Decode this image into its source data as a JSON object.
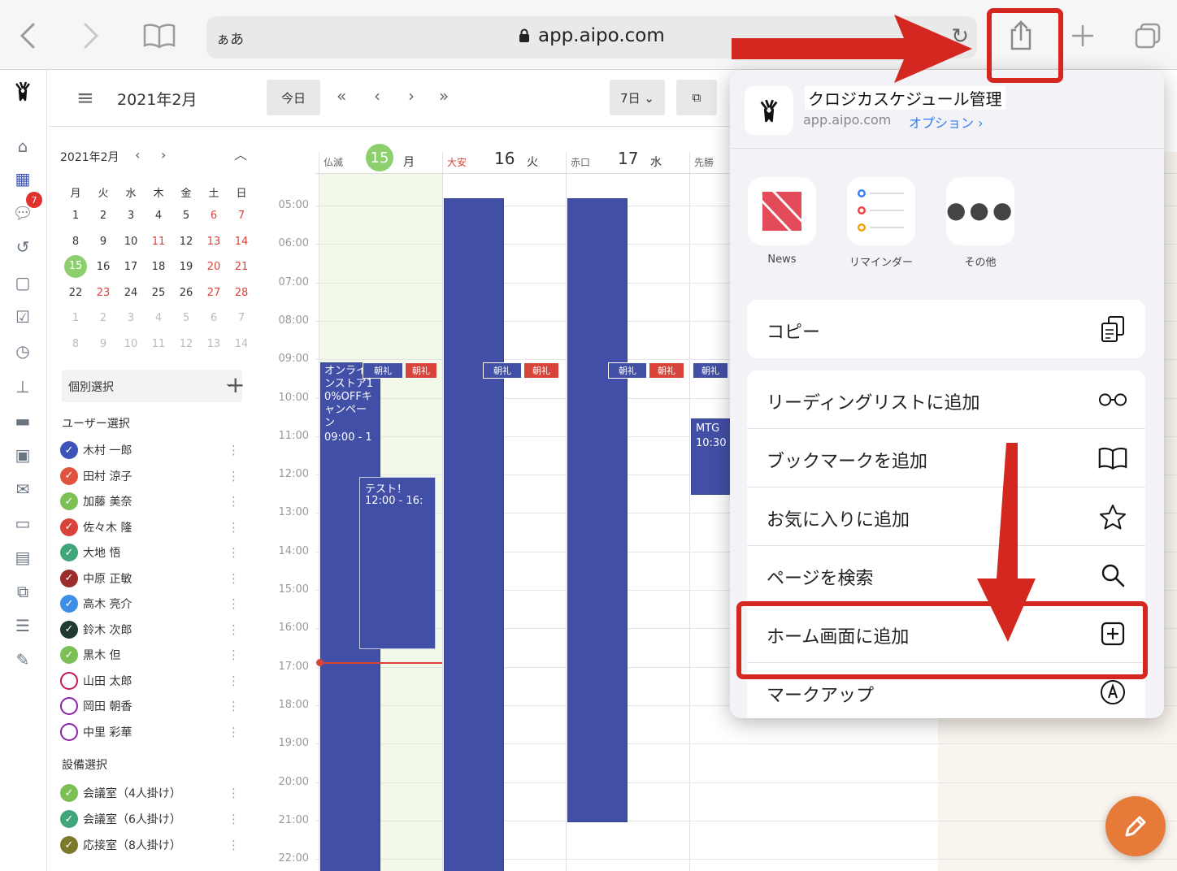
{
  "browser": {
    "text_size_label": "ぁあ",
    "url": "app.aipo.com"
  },
  "sidebar": {
    "chat_badge": "7"
  },
  "header": {
    "month_title": "2021年2月",
    "today_button": "今日",
    "range_select": "7日 ⌄"
  },
  "mini_calendar": {
    "title": "2021年2月",
    "prev": "‹",
    "next": "›",
    "weekdays": [
      "月",
      "火",
      "水",
      "木",
      "金",
      "土",
      "日"
    ],
    "weeks": [
      [
        "1",
        "2",
        "3",
        "4",
        "5",
        "6",
        "7"
      ],
      [
        "8",
        "9",
        "10",
        "11",
        "12",
        "13",
        "14"
      ],
      [
        "15",
        "16",
        "17",
        "18",
        "19",
        "20",
        "21"
      ],
      [
        "22",
        "23",
        "24",
        "25",
        "26",
        "27",
        "28"
      ],
      [
        "1",
        "2",
        "3",
        "4",
        "5",
        "6",
        "7"
      ],
      [
        "8",
        "9",
        "10",
        "11",
        "12",
        "13",
        "14"
      ]
    ]
  },
  "filters": {
    "group_select": "個別選択",
    "user_section": "ユーザー選択",
    "users": [
      {
        "name": "木村 一郎",
        "color": "#3d53b8",
        "checked": true
      },
      {
        "name": "田村 涼子",
        "color": "#e0533c",
        "checked": true
      },
      {
        "name": "加藤 美奈",
        "color": "#7cbf55",
        "checked": true
      },
      {
        "name": "佐々木 隆",
        "color": "#d9443a",
        "checked": true
      },
      {
        "name": "大地 悟",
        "color": "#3fa57a",
        "checked": true
      },
      {
        "name": "中原 正敏",
        "color": "#9b2d2d",
        "checked": true
      },
      {
        "name": "高木 亮介",
        "color": "#3d8ee6",
        "checked": true
      },
      {
        "name": "鈴木 次郎",
        "color": "#1f3a32",
        "checked": true
      },
      {
        "name": "黒木 但",
        "color": "#7cbf55",
        "checked": true
      },
      {
        "name": "山田 太郎",
        "color": "#c2185b",
        "checked": false
      },
      {
        "name": "岡田 朝香",
        "color": "#8e24aa",
        "checked": false
      },
      {
        "name": "中里 彩華",
        "color": "#8e24aa",
        "checked": false
      }
    ],
    "facility_section": "設備選択",
    "facilities": [
      {
        "name": "会議室（4人掛け）",
        "color": "#7cbf55"
      },
      {
        "name": "会議室（6人掛け）",
        "color": "#3fa57a"
      },
      {
        "name": "応接室（8人掛け）",
        "color": "#7a7a2a"
      }
    ]
  },
  "days": [
    {
      "rokuyo": "仏滅",
      "date": "15",
      "dow": "月",
      "today": true
    },
    {
      "rokuyo": "大安",
      "date": "16",
      "dow": "火",
      "today": false
    },
    {
      "rokuyo": "赤口",
      "date": "17",
      "dow": "水",
      "today": false
    },
    {
      "rokuyo": "先勝",
      "date": "",
      "dow": "",
      "today": false
    }
  ],
  "times": [
    "05:00",
    "06:00",
    "07:00",
    "08:00",
    "09:00",
    "10:00",
    "11:00",
    "12:00",
    "13:00",
    "14:00",
    "15:00",
    "16:00",
    "17:00",
    "18:00",
    "19:00",
    "20:00",
    "21:00",
    "22:00"
  ],
  "events": {
    "campaign_text": "オンラインストア10%OFFキャンペーン",
    "campaign_time": "09:00 - 1",
    "test_title": "テスト！",
    "test_time": "12:00 - 16:",
    "mtg_title": "MTG",
    "mtg_time": "10:30",
    "morning_tag": "朝礼"
  },
  "share_sheet": {
    "site_title": "クロジカスケジュール管理",
    "site_url": "app.aipo.com",
    "options_link": "オプション ›",
    "apps": [
      {
        "label": "News",
        "icon": "news-icon"
      },
      {
        "label": "リマインダー",
        "icon": "reminders-icon"
      },
      {
        "label": "その他",
        "icon": "more-icon"
      }
    ],
    "copy": "コピー",
    "actions": [
      {
        "label": "リーディングリストに追加",
        "icon": "glasses-icon"
      },
      {
        "label": "ブックマークを追加",
        "icon": "book-icon"
      },
      {
        "label": "お気に入りに追加",
        "icon": "star-icon"
      },
      {
        "label": "ページを検索",
        "icon": "search-icon"
      },
      {
        "label": "ホーム画面に追加",
        "icon": "plus-square-icon"
      },
      {
        "label": "マークアップ",
        "icon": "markup-icon"
      }
    ]
  },
  "colors": {
    "event_blue": "#424fa6",
    "tag_red": "#d9443a",
    "annotation_red": "#d4271f",
    "link_blue": "#2f7bf6",
    "today_green": "#8ccf6c",
    "fab_orange": "#e57a39"
  }
}
